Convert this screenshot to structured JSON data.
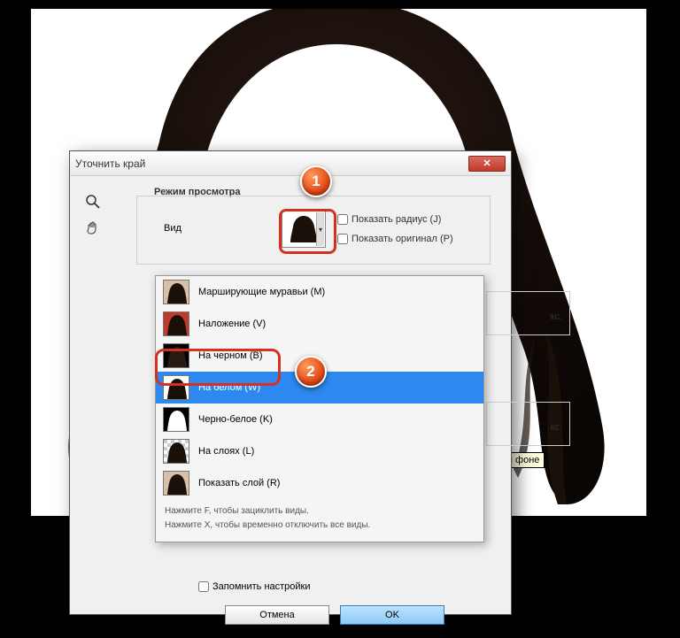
{
  "dialog": {
    "title": "Уточнить край",
    "section_view": "Режим просмотра",
    "view_label": "Вид",
    "show_radius": "Показать радиус (J)",
    "show_original": "Показать оригинал (P)",
    "remember": "Запомнить настройки",
    "cancel": "Отмена",
    "ok": "OK",
    "peek_unit": "кс."
  },
  "dropdown": {
    "items": [
      {
        "label": "Марширующие муравьи (M)",
        "bg": "#d8bfa6"
      },
      {
        "label": "Наложение (V)",
        "bg": "#c0392b"
      },
      {
        "label": "На черном (B)",
        "bg": "#000000"
      },
      {
        "label": "На белом (W)",
        "bg": "#ffffff"
      },
      {
        "label": "Черно-белое (K)",
        "bg": "#000000"
      },
      {
        "label": "На слоях (L)",
        "bg": "#c8c8c8"
      },
      {
        "label": "Показать слой (R)",
        "bg": "#d8bfa6"
      }
    ],
    "hint1": "Нажмите F, чтобы зациклить виды.",
    "hint2": "Нажмите X, чтобы временно отключить все виды."
  },
  "tooltip": "елом фоне",
  "badges": {
    "b1": "1",
    "b2": "2"
  }
}
